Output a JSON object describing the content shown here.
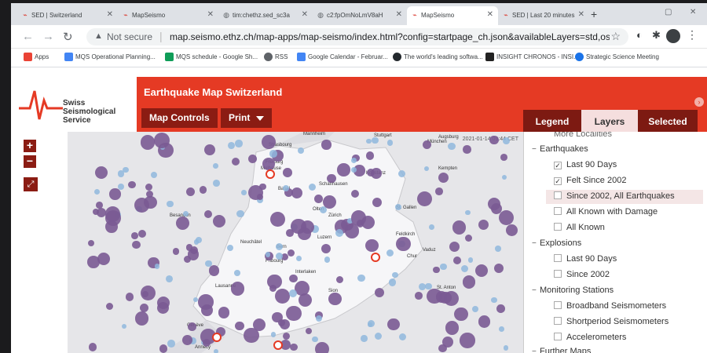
{
  "browser": {
    "tabs": [
      {
        "label": "SED | Switzerland",
        "icon": "seismo-icon"
      },
      {
        "label": "MapSeismo",
        "icon": "seismo-icon"
      },
      {
        "label": "tim:chethz.sed_sc3a",
        "icon": "globe-icon"
      },
      {
        "label": "c2:fpOmNoLmV8aH",
        "icon": "globe-icon"
      },
      {
        "label": "MapSeismo",
        "icon": "seismo-icon"
      },
      {
        "label": "SED | Last 20 minutes",
        "icon": "seismo-icon"
      }
    ],
    "new_tab": "+",
    "not_secure": "Not secure",
    "url": "map.seismo.ethz.ch/map-apps/map-seismo/index.html?config=startpage_ch.json&availableLayers=std,osm,waterma..."
  },
  "bookmarks": [
    {
      "label": "Apps",
      "color": "#ea4335"
    },
    {
      "label": "MQS Operational Planning...",
      "color": "#4285f4"
    },
    {
      "label": "MQS schedule - Google Sh...",
      "color": "#0f9d58"
    },
    {
      "label": "RSS",
      "color": "#5f6368"
    },
    {
      "label": "Google Calendar - Februar...",
      "color": "#4285f4"
    },
    {
      "label": "The world's leading softwa...",
      "color": "#24292e"
    },
    {
      "label": "INSIGHT CHRONOS - INSI...",
      "color": "#222222"
    },
    {
      "label": "Strategic Science Meeting",
      "color": "#1a73e8"
    }
  ],
  "logo": {
    "line1": "Swiss Seismological",
    "line2": "Service"
  },
  "header": {
    "title": "Earthquake Map Switzerland",
    "map_controls": "Map Controls",
    "print": "Print"
  },
  "panel_tabs": [
    "Legend",
    "Layers",
    "Selected"
  ],
  "zoom": {
    "in": "+",
    "out": "−"
  },
  "map": {
    "date": "2021-01-14 09:44 CET",
    "cities": [
      "Mannheim",
      "Strasbourg",
      "Stuttgart",
      "Augsburg",
      "München",
      "Freiburg",
      "Mulhouse",
      "Basel",
      "Schaffhausen",
      "Konstanz",
      "Kempten",
      "Olten",
      "Zürich",
      "St. Gallen",
      "Besançon",
      "Feldkirch",
      "Neuchâtel",
      "Luzern",
      "Vaduz",
      "Bern",
      "St. Anton",
      "Fribourg",
      "Chur",
      "Interlaken",
      "Lausanne",
      "Sion",
      "Genève",
      "Annecy"
    ]
  },
  "layers": {
    "top_cut": "More Localities",
    "groups": [
      {
        "label": "Earthquakes",
        "items": [
          {
            "label": "Last 90 Days",
            "checked": true
          },
          {
            "label": "Felt Since 2002",
            "checked": true
          },
          {
            "label": "Since 2002, All Earthquakes",
            "checked": false
          },
          {
            "label": "All Known with Damage",
            "checked": false
          },
          {
            "label": "All Known",
            "checked": false
          }
        ]
      },
      {
        "label": "Explosions",
        "items": [
          {
            "label": "Last 90 Days",
            "checked": false
          },
          {
            "label": "Since 2002",
            "checked": false
          }
        ]
      },
      {
        "label": "Monitoring Stations",
        "items": [
          {
            "label": "Broadband Seismometers",
            "checked": false
          },
          {
            "label": "Shortperiod Seismometers",
            "checked": false
          },
          {
            "label": "Accelerometers",
            "checked": false
          }
        ]
      },
      {
        "label": "Further Maps",
        "items": []
      }
    ]
  },
  "colors": {
    "accent": "#e53a24",
    "dark_accent": "#8b1c13",
    "quake": "#7a5a93",
    "quake_recent": "#8fb7dd"
  }
}
